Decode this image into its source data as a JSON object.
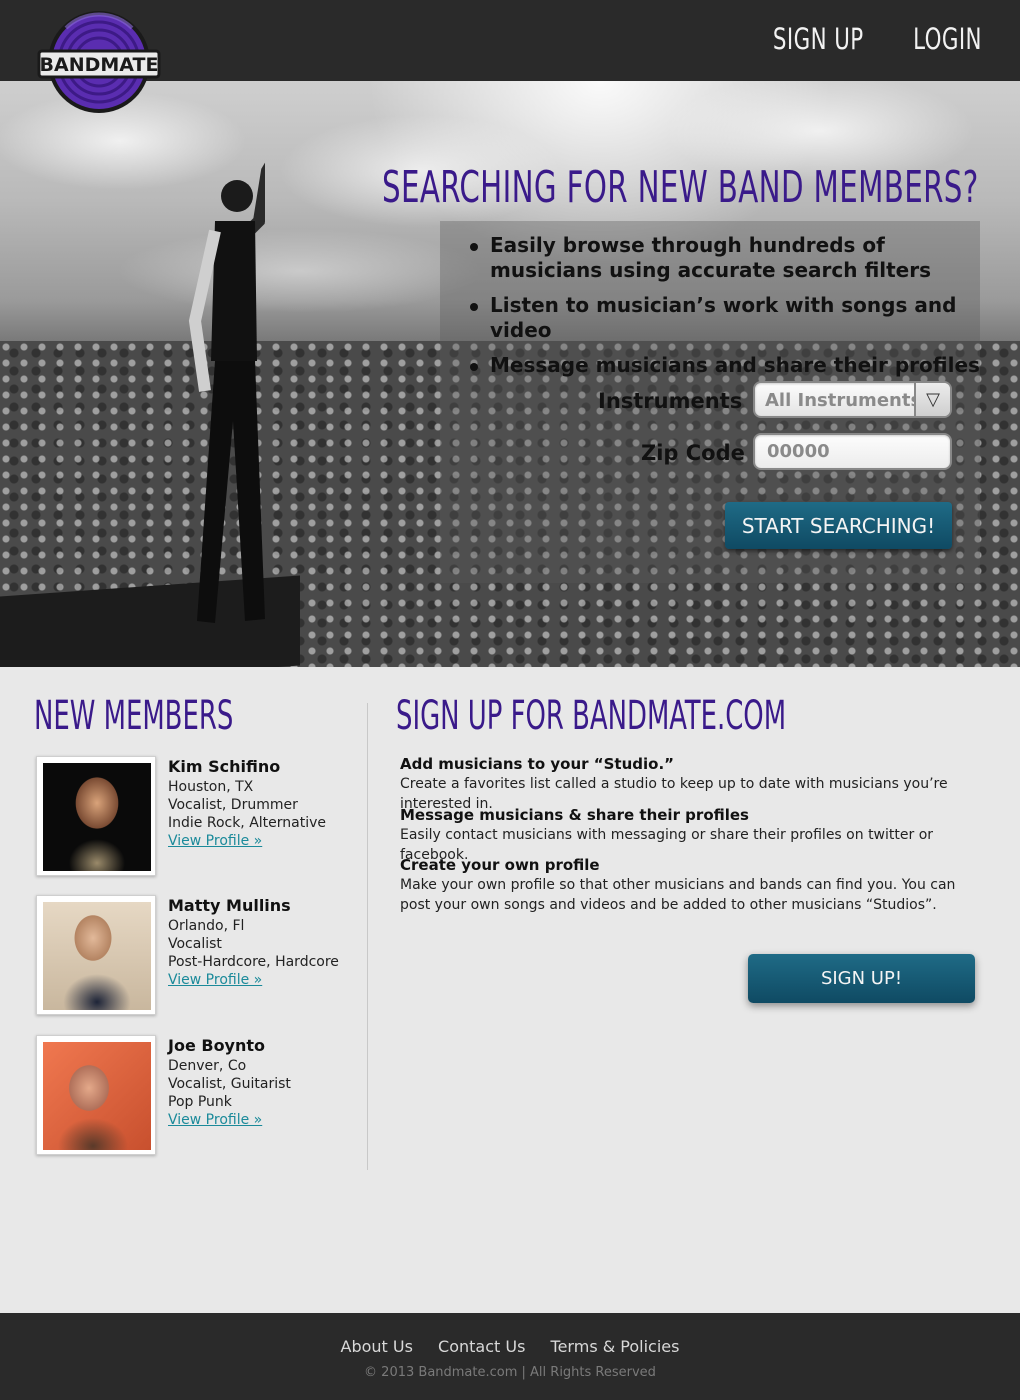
{
  "header": {
    "logo_text": "BANDMATE",
    "nav": {
      "signup": "SIGN UP",
      "login": "LOGIN"
    }
  },
  "hero": {
    "title": "SEARCHING FOR NEW BAND MEMBERS?",
    "bullets": [
      "Easily browse through hundreds of musicians using accurate search filters",
      "Listen to musician’s work with songs and video",
      "Message musicians and share their profiles"
    ],
    "form": {
      "instruments_label": "Instruments",
      "instruments_value": "All Instruments",
      "zip_label": "Zip Code",
      "zip_placeholder": "00000",
      "search_button": "START SEARCHING!"
    }
  },
  "new_members": {
    "title": "NEW MEMBERS",
    "members": [
      {
        "name": "Kim Schifino",
        "location": "Houston, TX",
        "roles": "Vocalist, Drummer",
        "genres": "Indie Rock, Alternative",
        "link": "View Profile »"
      },
      {
        "name": "Matty Mullins",
        "location": "Orlando, Fl",
        "roles": "Vocalist",
        "genres": "Post-Hardcore, Hardcore",
        "link": "View Profile »"
      },
      {
        "name": "Joe Boynto",
        "location": "Denver, Co",
        "roles": "Vocalist, Guitarist",
        "genres": "Pop Punk",
        "link": "View Profile »"
      }
    ]
  },
  "signup": {
    "title": "SIGN UP FOR BANDMATE.COM",
    "features": [
      {
        "heading": "Add musicians to your “Studio.”",
        "body": "Create a favorites list called a studio to keep up to date with musicians you’re interested in."
      },
      {
        "heading": "Message musicians & share their profiles",
        "body": "Easily contact musicians with messaging or share  their profiles on twitter or facebook."
      },
      {
        "heading": "Create your own profile",
        "body": "Make your own profile so that other musicians and bands can find you. You can post your own songs and videos and be added to other  musicians “Studios”."
      }
    ],
    "button": "SIGN UP!"
  },
  "footer": {
    "links": [
      "About Us",
      "Contact Us",
      "Terms & Policies"
    ],
    "copyright": "© 2013 Bandmate.com | All Rights Reserved"
  },
  "colors": {
    "accent_purple": "#3a1a8a",
    "button_teal": "#17607c",
    "link_teal": "#1b8a9a",
    "bar_dark": "#2a2a2a"
  }
}
